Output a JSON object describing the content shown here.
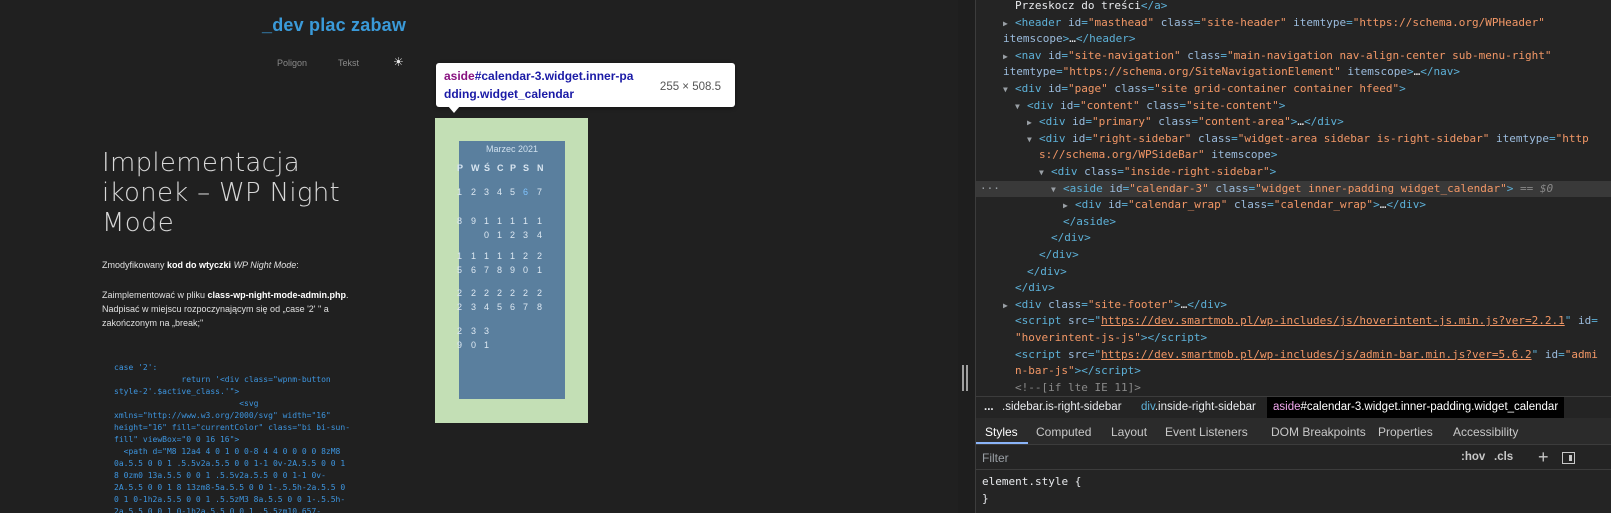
{
  "site": {
    "title": "_dev plac zabaw",
    "nav": [
      "Poligon",
      "Tekst"
    ],
    "theme_icon": "sun-icon"
  },
  "post": {
    "title": "Implementacja ikonek – WP Night Mode",
    "p1": {
      "t1": "Zmodyfikowany ",
      "b1": "kod do wtyczki",
      "t2": " ",
      "i1": "WP Night Mode",
      "t3": ":"
    },
    "p2": {
      "t1": "Zaimplementować w pliku ",
      "b1": "class-wp-night-mode-admin.php",
      "t2": ". Nadpisać w miejscu rozpoczynającym się od „case '2' \" a zakończonym na „break;\""
    },
    "code": "case '2':\n              return '<div class=\"wpnm-button\nstyle-2'.$active_class.'\">\n                          <svg\nxmlns=\"http://www.w3.org/2000/svg\" width=\"16\"\nheight=\"16\" fill=\"currentColor\" class=\"bi bi-sun-\nfill\" viewBox=\"0 0 16 16\">\n  <path d=\"M8 12a4 4 0 1 0 0-8 4 4 0 0 0 0 8zM8\n0a.5.5 0 0 1 .5.5v2a.5.5 0 0 1-1 0v-2A.5.5 0 0 1\n8 0zm0 13a.5.5 0 0 1 .5.5v2a.5.5 0 0 1-1 0v-\n2A.5.5 0 0 1 8 13zm8-5a.5.5 0 0 1-.5.5h-2a.5.5 0\n0 1 0-1h2a.5.5 0 0 1 .5.5zM3 8a.5.5 0 0 1-.5.5h-\n2a.5.5 0 0 1 0-1h2a.5.5 0 0 1 .5.5zm10.657-"
  },
  "calendar": {
    "caption": "Marzec 2021",
    "headers": [
      "P",
      "W",
      "Ś",
      "C",
      "P",
      "S",
      "N"
    ],
    "rows": [
      [
        "1",
        "2",
        "3",
        "4",
        "5",
        "6",
        "7"
      ],
      [
        "8",
        "9",
        "10",
        "11",
        "12",
        "13",
        "14"
      ],
      [
        "15",
        "16",
        "17",
        "18",
        "19",
        "20",
        "21"
      ],
      [
        "22",
        "23",
        "24",
        "25",
        "26",
        "27",
        "28"
      ],
      [
        "29",
        "30",
        "31",
        "",
        "",
        "",
        ""
      ]
    ],
    "linked_day": "6",
    "link_color": "#7fc4ff"
  },
  "tooltip": {
    "tag": "aside",
    "line1_rest": "#calendar-3.widget.inner-pa",
    "line2": "dding.widget_calendar",
    "size": "255 × 508.5"
  },
  "devtools": {
    "tree": [
      "Przeskocz do treści</a>",
      "header",
      "nav",
      "page",
      "content",
      "primary",
      "right-sidebar",
      "inside",
      "aside",
      "wrap"
    ],
    "tree_text": {
      "skip": "Przeskocz do treści",
      "header_id": "\"masthead\"",
      "header_class": "\"site-header\"",
      "header_itemtype": "\"https://schema.org/WPHeader\"",
      "nav_id": "\"site-navigation\"",
      "nav_class": "\"main-navigation nav-align-center sub-menu-right\"",
      "nav_itemtype": "\"https://schema.org/SiteNavigationElement\"",
      "page_id": "\"page\"",
      "page_class": "\"site grid-container container hfeed\"",
      "content_id": "\"content\"",
      "content_class": "\"site-content\"",
      "primary_id": "\"primary\"",
      "primary_class": "\"content-area\"",
      "rs_id": "\"right-sidebar\"",
      "rs_class": "\"widget-area sidebar is-right-sidebar\"",
      "rs_itemtype_a": "\"http",
      "rs_itemtype_b": "s://schema.org/WPSideBar\"",
      "irs_class": "\"inside-right-sidebar\"",
      "aside_id": "\"calendar-3\"",
      "aside_class": "\"widget inner-padding widget_calendar\"",
      "dollar0": "== $0",
      "wrap_id": "\"calendar_wrap\"",
      "wrap_class": "\"calendar_wrap\"",
      "footer_class": "\"site-footer\"",
      "script1_src": "https://dev.smartmob.pl/wp-includes/js/hoverintent-js.min.js?ver=2.2.1",
      "script1_id": "\"hoverintent-js-js\"",
      "script2_src": "https://dev.smartmob.pl/wp-includes/js/admin-bar.min.js?ver=5.6.2",
      "script2_id_a": "\"admi",
      "script2_id_b": "n-bar-js\"",
      "comment": "<!--[if lte IE 11]>"
    },
    "breadcrumbs": {
      "more": "...",
      "c1": ".sidebar.is-right-sidebar",
      "c2_tag": "div",
      "c2_rest": ".inside-right-sidebar",
      "c3_tag": "aside",
      "c3_rest": "#calendar-3.widget.inner-padding.widget_calendar"
    },
    "tabs": [
      "Styles",
      "Computed",
      "Layout",
      "Event Listeners",
      "DOM Breakpoints",
      "Properties",
      "Accessibility"
    ],
    "filter_placeholder": "Filter",
    "hov": ":hov",
    "cls": ".cls",
    "element_style_open": "element.style {",
    "element_style_close": "}"
  }
}
